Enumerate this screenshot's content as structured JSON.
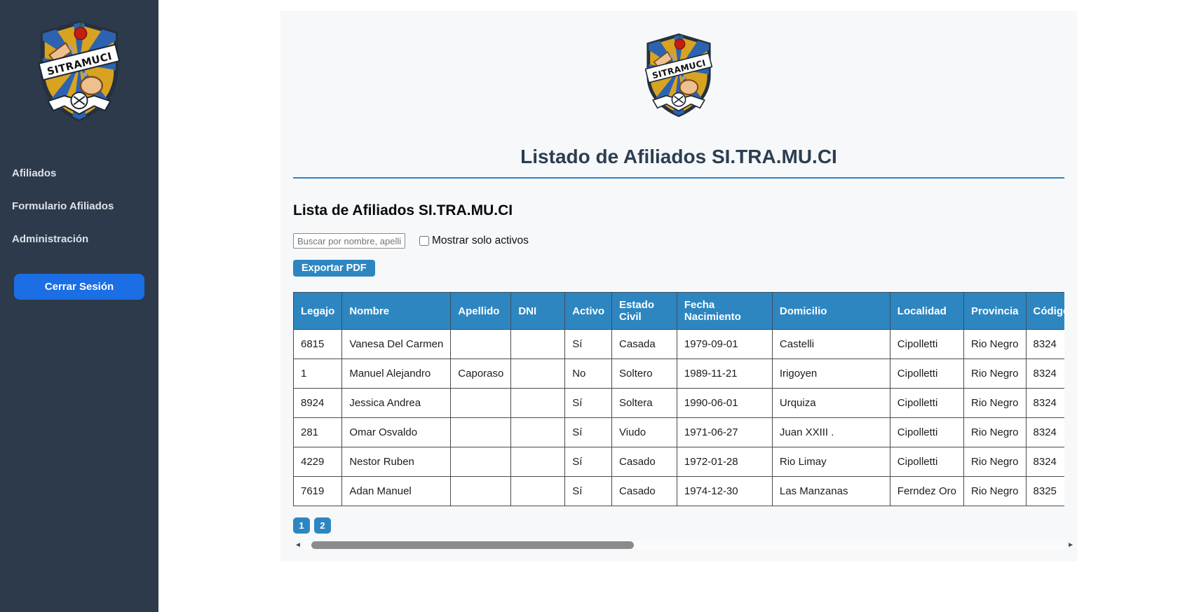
{
  "logo_text": "SITRAMUCI",
  "sidebar": {
    "items": [
      {
        "label": "Afiliados"
      },
      {
        "label": "Formulario Afiliados"
      },
      {
        "label": "Administración"
      }
    ],
    "logout_label": "Cerrar Sesión"
  },
  "main": {
    "title": "Listado de Afiliados SI.TRA.MU.CI",
    "subtitle": "Lista de Afiliados SI.TRA.MU.CI",
    "search_placeholder": "Buscar por nombre, apellido,",
    "checkbox_label": "Mostrar solo activos",
    "checkbox_checked": false,
    "export_button": "Exportar PDF",
    "table": {
      "headers": [
        "Legajo",
        "Nombre",
        "Apellido",
        "DNI",
        "Activo",
        "Estado Civil",
        "Fecha Nacimiento",
        "Domicilio",
        "Localidad",
        "Provincia",
        "Código"
      ],
      "rows": [
        [
          "6815",
          "Vanesa Del Carmen",
          "",
          "",
          "Sí",
          "Casada",
          "1979-09-01",
          "Castelli",
          "Cipolletti",
          "Rio Negro",
          "8324"
        ],
        [
          "1",
          "Manuel Alejandro",
          "Caporaso",
          "",
          "No",
          "Soltero",
          "1989-11-21",
          "Irigoyen",
          "Cipolletti",
          "Rio Negro",
          "8324"
        ],
        [
          "8924",
          "Jessica Andrea",
          "",
          "",
          "Sí",
          "Soltera",
          "1990-06-01",
          "Urquiza",
          "Cipolletti",
          "Rio Negro",
          "8324"
        ],
        [
          "281",
          "Omar Osvaldo",
          "",
          "",
          "Sí",
          "Viudo",
          "1971-06-27",
          "Juan XXIII .",
          "Cipolletti",
          "Rio Negro",
          "8324"
        ],
        [
          "4229",
          "Nestor Ruben",
          "",
          "",
          "Sí",
          "Casado",
          "1972-01-28",
          "Rio Limay",
          "Cipolletti",
          "Rio Negro",
          "8324"
        ],
        [
          "7619",
          "Adan Manuel",
          "",
          "",
          "Sí",
          "Casado",
          "1974-12-30",
          "Las Manzanas",
          "Ferndez Oro",
          "Rio Negro",
          "8325"
        ]
      ]
    },
    "pagination": [
      "1",
      "2"
    ],
    "icons": {
      "scroll_left": "◄",
      "scroll_right": "►"
    }
  },
  "colors": {
    "sidebar_bg": "#2d3a4b",
    "accent_blue": "#2e86c1",
    "logout_blue": "#1b6ee3",
    "title_color": "#2c3e50",
    "emblem_gold": "#d7a321",
    "emblem_blue": "#2c63b0",
    "emblem_apple_red": "#c41e12"
  }
}
